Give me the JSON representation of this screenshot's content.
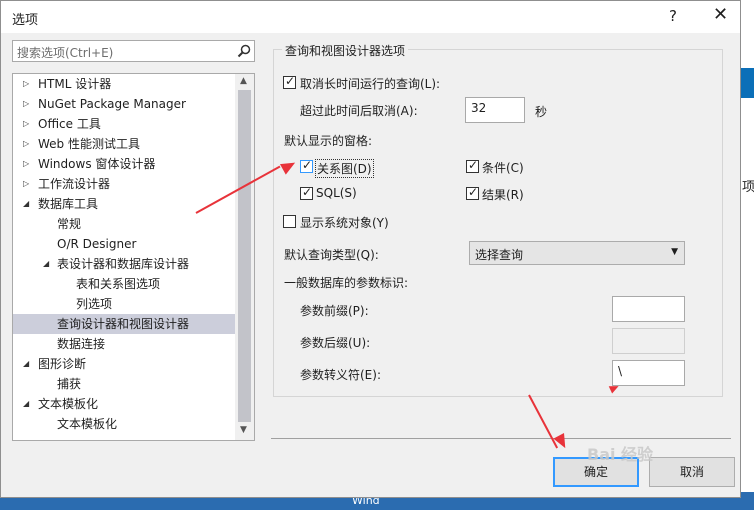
{
  "window": {
    "title": "选项",
    "help": "?",
    "close": "✕"
  },
  "search": {
    "placeholder": "搜索选项(Ctrl+E)"
  },
  "tree": [
    {
      "label": "HTML 设计器",
      "arrow": "▷"
    },
    {
      "label": "NuGet Package Manager",
      "arrow": "▷"
    },
    {
      "label": "Office 工具",
      "arrow": "▷"
    },
    {
      "label": "Web 性能测试工具",
      "arrow": "▷"
    },
    {
      "label": "Windows 窗体设计器",
      "arrow": "▷"
    },
    {
      "label": "工作流设计器",
      "arrow": "▷"
    },
    {
      "label": "数据库工具",
      "arrow": "◢"
    },
    {
      "label": "常规",
      "arrow": ""
    },
    {
      "label": "O/R Designer",
      "arrow": ""
    },
    {
      "label": "表设计器和数据库设计器",
      "arrow": "◢"
    },
    {
      "label": "表和关系图选项",
      "arrow": ""
    },
    {
      "label": "列选项",
      "arrow": ""
    },
    {
      "label": "查询设计器和视图设计器",
      "arrow": ""
    },
    {
      "label": "数据连接",
      "arrow": ""
    },
    {
      "label": "图形诊断",
      "arrow": "◢"
    },
    {
      "label": "捕获",
      "arrow": ""
    },
    {
      "label": "文本模板化",
      "arrow": "◢"
    },
    {
      "label": "文本模板化",
      "arrow": ""
    }
  ],
  "panel": {
    "group_title": "查询和视图设计器选项",
    "cancel_long_query": {
      "label": "取消长时间运行的查询(L):",
      "checked": true
    },
    "timeout_label": "超过此时间后取消(A):",
    "timeout_value": "32",
    "timeout_unit": "秒",
    "default_panes_label": "默认显示的窗格:",
    "panes": {
      "diagram": {
        "label": "关系图(D)",
        "checked": true
      },
      "criteria": {
        "label": "条件(C)",
        "checked": true
      },
      "sql": {
        "label": "SQL(S)",
        "checked": true
      },
      "results": {
        "label": "结果(R)",
        "checked": true
      }
    },
    "show_system_objects": {
      "label": "显示系统对象(Y)",
      "checked": false
    },
    "default_query_type_label": "默认查询类型(Q):",
    "default_query_type_value": "选择查询",
    "params_header": "一般数据库的参数标识:",
    "param_prefix_label": "参数前缀(P):",
    "param_prefix_value": "",
    "param_suffix_label": "参数后缀(U):",
    "param_suffix_value": "",
    "param_escape_label": "参数转义符(E):",
    "param_escape_value": "\\"
  },
  "buttons": {
    "ok": "确定",
    "cancel": "取消"
  },
  "background": {
    "right_text": "项",
    "taskbar_text": "Wind"
  },
  "watermark": "Bai 经验",
  "icons": {
    "search": "search-icon",
    "arrow_collapsed": "triangle-right-icon",
    "arrow_expanded": "triangle-down-icon"
  },
  "colors": {
    "selection": "#cccedb",
    "annotation": "#e8333a",
    "focus_border": "#3399ff"
  }
}
